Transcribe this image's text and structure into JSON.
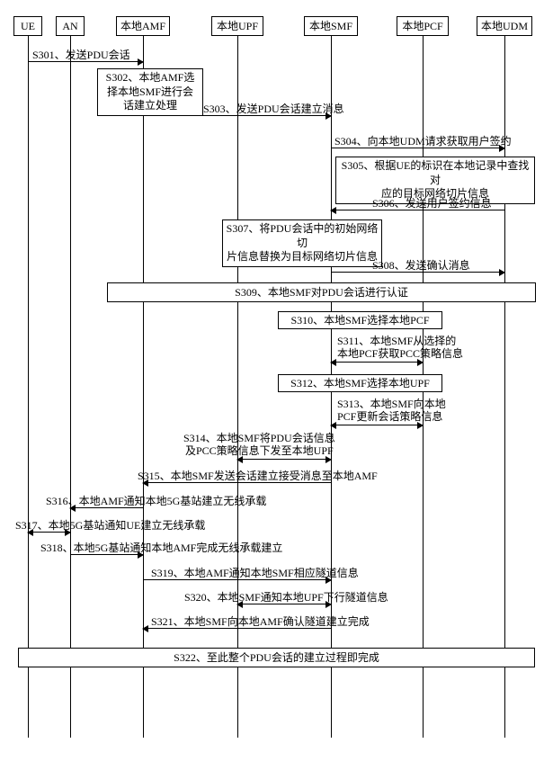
{
  "actors": {
    "ue": "UE",
    "an": "AN",
    "amf": "本地AMF",
    "upf": "本地UPF",
    "smf": "本地SMF",
    "pcf": "本地PCF",
    "udm": "本地UDM"
  },
  "steps": {
    "s301": "S301、发送PDU会话",
    "s302_l1": "S302、本地AMF选",
    "s302_l2": "择本地SMF进行会",
    "s302_l3": "话建立处理",
    "s303": "S303、发送PDU会话建立消息",
    "s304": "S304、向本地UDM请求获取用户签约",
    "s305_l1": "S305、根据UE的标识在本地记录中查找对",
    "s305_l2": "应的目标网络切片信息",
    "s306": "S306、发送用户签约信息",
    "s307_l1": "S307、将PDU会话中的初始网络切",
    "s307_l2": "片信息替换为目标网络切片信息",
    "s308": "S308、发送确认消息",
    "s309": "S309、本地SMF对PDU会话进行认证",
    "s310": "S310、本地SMF选择本地PCF",
    "s311_l1": "S311、本地SMF从选择的",
    "s311_l2": "本地PCF获取PCC策略信息",
    "s312": "S312、本地SMF选择本地UPF",
    "s313_l1": "S313、本地SMF向本地",
    "s313_l2": "PCF更新会话策略信息",
    "s314_l1": "S314、本地SMF将PDU会话信息",
    "s314_l2": "及PCC策略信息下发至本地UPF",
    "s315": "S315、本地SMF发送会话建立接受消息至本地AMF",
    "s316": "S316、本地AMF通知本地5G基站建立无线承载",
    "s317": "S317、本地5G基站通知UE建立无线承载",
    "s318": "S318、本地5G基站通知本地AMF完成无线承载建立",
    "s319": "S319、本地AMF通知本地SMF相应隧道信息",
    "s320": "S320、本地SMF通知本地UPF下行隧道信息",
    "s321": "S321、本地SMF向本地AMF确认隧道建立完成",
    "s322": "S322、至此整个PDU会话的建立过程即完成"
  }
}
